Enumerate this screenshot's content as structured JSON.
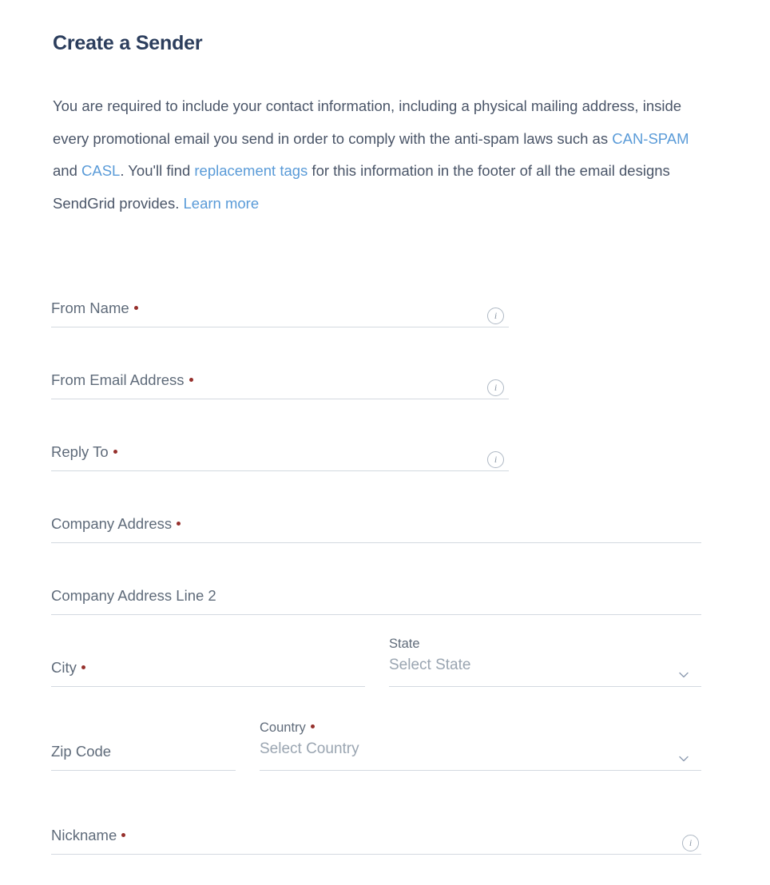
{
  "header": {
    "title": "Create a Sender"
  },
  "intro": {
    "part1": "You are required to include your contact information, including a physical mailing address, inside every promotional email you send in order to comply with the anti-spam laws such as ",
    "link_can_spam": "CAN-SPAM",
    "part2": " and ",
    "link_casl": "CASL",
    "part3": ". You'll find ",
    "link_replacement_tags": "replacement tags",
    "part4": " for this information in the footer of all the email designs SendGrid provides. ",
    "link_learn_more": "Learn more"
  },
  "form": {
    "from_name": {
      "label": "From Name",
      "required": true,
      "value": "",
      "placeholder": "",
      "info_icon": "info-icon"
    },
    "from_email": {
      "label": "From Email Address",
      "required": true,
      "value": "",
      "placeholder": "",
      "info_icon": "info-icon"
    },
    "reply_to": {
      "label": "Reply To",
      "required": true,
      "value": "",
      "placeholder": "",
      "info_icon": "info-icon"
    },
    "company_address": {
      "label": "Company Address",
      "required": true,
      "value": "",
      "placeholder": ""
    },
    "company_address_2": {
      "label": "Company Address Line 2",
      "required": false,
      "value": "",
      "placeholder": ""
    },
    "city": {
      "label": "City",
      "required": true,
      "value": "",
      "placeholder": ""
    },
    "state": {
      "label": "State",
      "required": false,
      "selected": "Select State",
      "chevron_icon": "chevron-down-icon"
    },
    "zip_code": {
      "label": "Zip Code",
      "required": false,
      "value": "",
      "placeholder": ""
    },
    "country": {
      "label": "Country",
      "required": true,
      "selected": "Select Country",
      "chevron_icon": "chevron-down-icon"
    },
    "nickname": {
      "label": "Nickname",
      "required": true,
      "value": "",
      "placeholder": "",
      "info_icon": "info-icon"
    }
  },
  "colors": {
    "title": "#2c3e5d",
    "body_text": "#4a5568",
    "link": "#5a9bd8",
    "label": "#5f6b7a",
    "required_dot": "#96302c",
    "underline": "#d3d9e0",
    "placeholder": "#9aa5b1",
    "icon_border": "#aeb8c4",
    "background": "#ffffff"
  }
}
